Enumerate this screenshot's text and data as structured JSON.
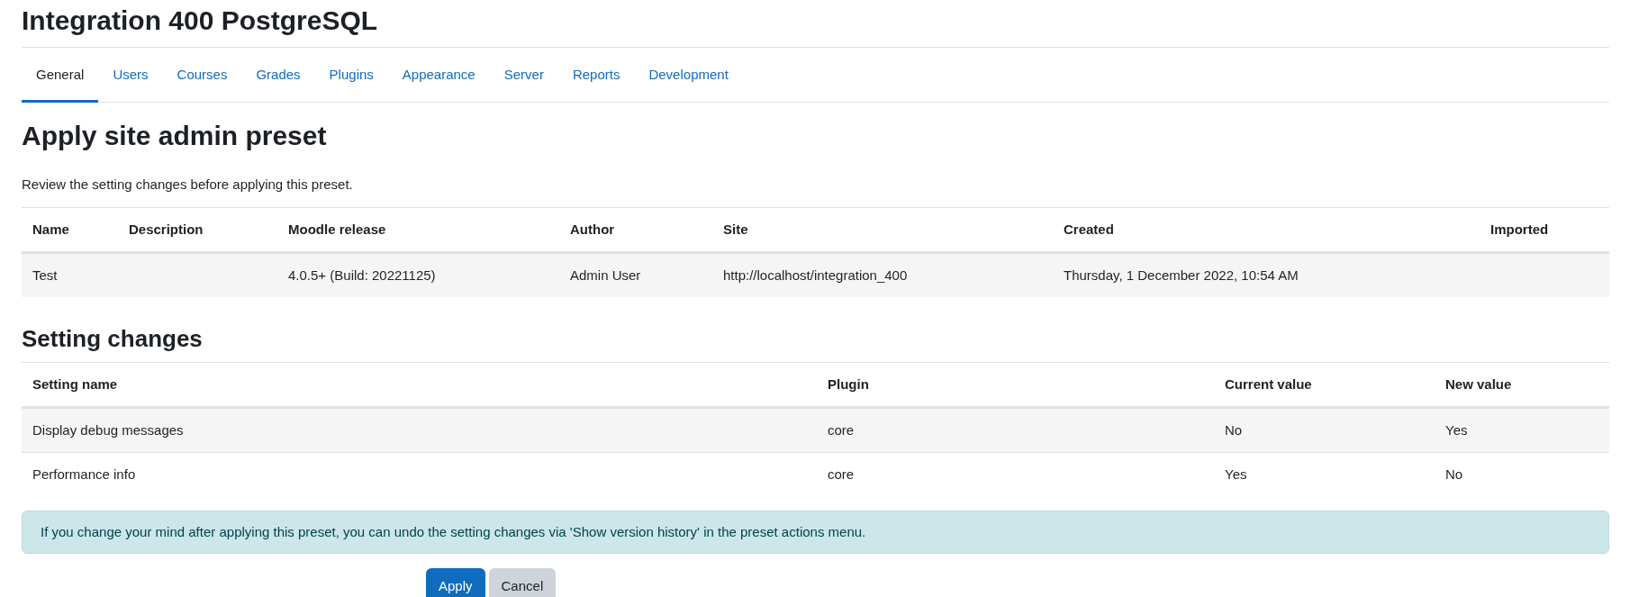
{
  "page_title": "Integration 400 PostgreSQL",
  "tabs": [
    {
      "label": "General",
      "selected": true
    },
    {
      "label": "Users",
      "selected": false
    },
    {
      "label": "Courses",
      "selected": false
    },
    {
      "label": "Grades",
      "selected": false
    },
    {
      "label": "Plugins",
      "selected": false
    },
    {
      "label": "Appearance",
      "selected": false
    },
    {
      "label": "Server",
      "selected": false
    },
    {
      "label": "Reports",
      "selected": false
    },
    {
      "label": "Development",
      "selected": false
    }
  ],
  "heading": "Apply site admin preset",
  "intro": "Review the setting changes before applying this preset.",
  "preset_table": {
    "columns": [
      "Name",
      "Description",
      "Moodle release",
      "Author",
      "Site",
      "Created",
      "Imported"
    ],
    "rows": [
      [
        "Test",
        "",
        "4.0.5+ (Build: 20221125)",
        "Admin User",
        "http://localhost/integration_400",
        "Thursday, 1 December 2022, 10:54 AM",
        ""
      ]
    ]
  },
  "changes_heading": "Setting changes",
  "changes_table": {
    "columns": [
      "Setting name",
      "Plugin",
      "Current value",
      "New value"
    ],
    "rows": [
      [
        "Display debug messages",
        "core",
        "No",
        "Yes"
      ],
      [
        "Performance info",
        "core",
        "Yes",
        "No"
      ]
    ]
  },
  "alert": "If you change your mind after applying this preset, you can undo the setting changes via 'Show version history' in the preset actions menu.",
  "buttons": [
    {
      "label": "Apply",
      "kind": "primary"
    },
    {
      "label": "Cancel",
      "kind": "secondary"
    }
  ]
}
